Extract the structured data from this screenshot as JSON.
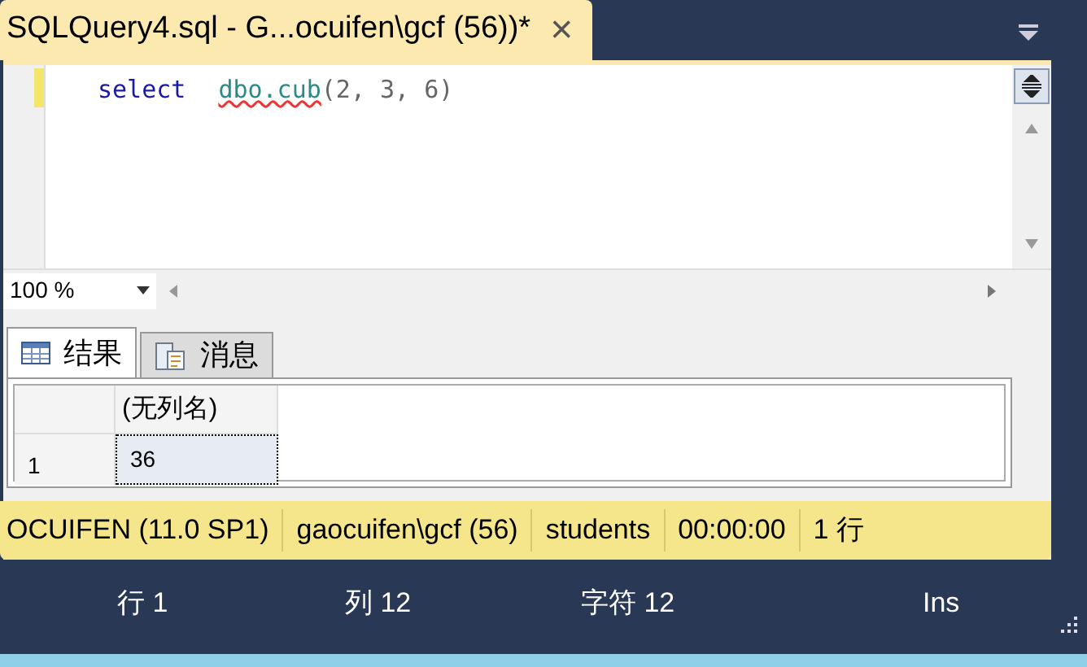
{
  "document_tab": {
    "title": "SQLQuery4.sql - G...ocuifen\\gcf (56))*",
    "close": "×",
    "selected": true
  },
  "editor": {
    "tokens": [
      {
        "text": "select",
        "kind": "keyword",
        "squiggle": false
      },
      {
        "text": "dbo.cub",
        "kind": "identifier",
        "squiggle": true
      },
      {
        "text": "(2, 3, 6)",
        "kind": "plain",
        "squiggle": false
      }
    ]
  },
  "zoom": {
    "value": "100 %"
  },
  "result_tabs": [
    {
      "label": "结果",
      "selected": true
    },
    {
      "label": "消息",
      "selected": false
    }
  ],
  "grid": {
    "columns": [
      "(无列名)"
    ],
    "rows": [
      {
        "number": "1",
        "cells": [
          "36"
        ],
        "selected": true
      }
    ]
  },
  "query_status": [
    "OCUIFEN (11.0 SP1)",
    "gaocuifen\\gcf (56)",
    "students",
    "00:00:00",
    "1 行"
  ],
  "status_bar": [
    "行 1",
    "列 12",
    "字符 12",
    "Ins"
  ]
}
